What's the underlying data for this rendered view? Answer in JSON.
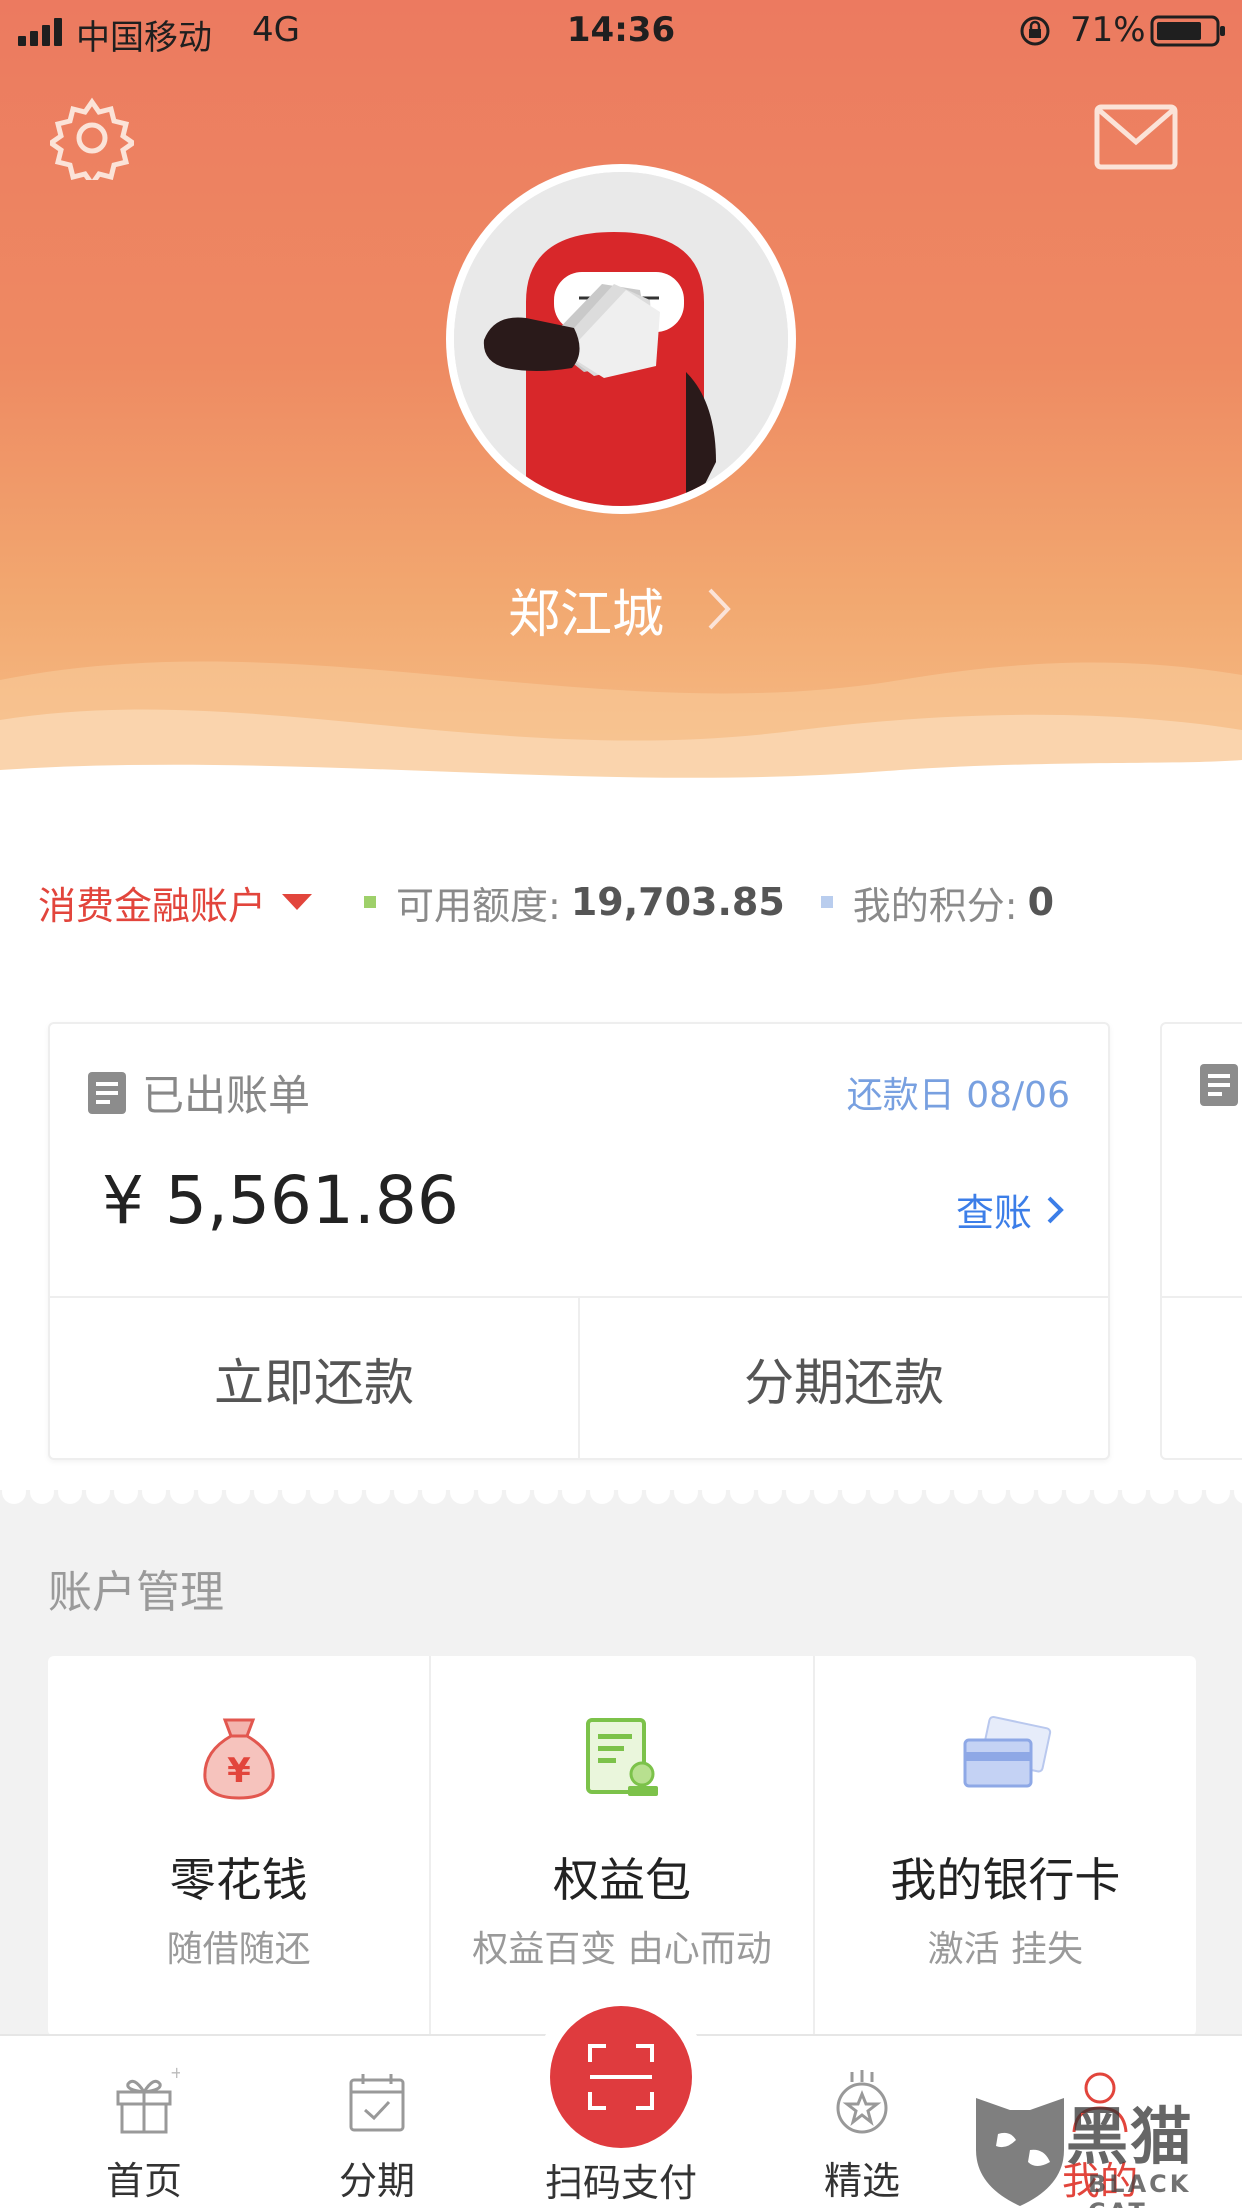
{
  "status_bar": {
    "carrier": "中国移动",
    "network": "4G",
    "time": "14:36",
    "battery_percent": "71%"
  },
  "header": {
    "username": "郑江城"
  },
  "account_bar": {
    "account_type": "消费金融账户",
    "available_label": "可用额度:",
    "available_value": "19,703.85",
    "points_label": "我的积分:",
    "points_value": "0"
  },
  "bill_card": {
    "title": "已出账单",
    "due_label": "还款日 08/06",
    "amount": "¥ 5,561.86",
    "check_link": "查账",
    "actions": [
      "立即还款",
      "分期还款"
    ]
  },
  "account_management": {
    "title": "账户管理",
    "items": [
      {
        "label": "零花钱",
        "sub": "随借随还",
        "icon": "money-bag-icon"
      },
      {
        "label": "权益包",
        "sub": "权益百变 由心而动",
        "icon": "benefit-doc-icon"
      },
      {
        "label": "我的银行卡",
        "sub": "激活 挂失",
        "icon": "bank-card-icon"
      }
    ]
  },
  "tab_bar": {
    "items": [
      {
        "label": "首页",
        "icon": "gift-icon"
      },
      {
        "label": "分期",
        "icon": "calendar-icon"
      },
      {
        "label": "扫码支付",
        "icon": "scan-icon"
      },
      {
        "label": "精选",
        "icon": "star-badge-icon"
      },
      {
        "label": "我的",
        "icon": "person-icon"
      }
    ]
  },
  "watermark": {
    "text": "黑猫",
    "subtext": "BLACK CAT"
  },
  "colors": {
    "header_top": "#ec7a60",
    "header_bottom": "#f6c08a",
    "accent_red": "#e2453c",
    "link_blue": "#3c7ee8",
    "due_blue": "#78a0e0",
    "credit_dot": "#9ed06a",
    "points_dot": "#b9cdee"
  }
}
